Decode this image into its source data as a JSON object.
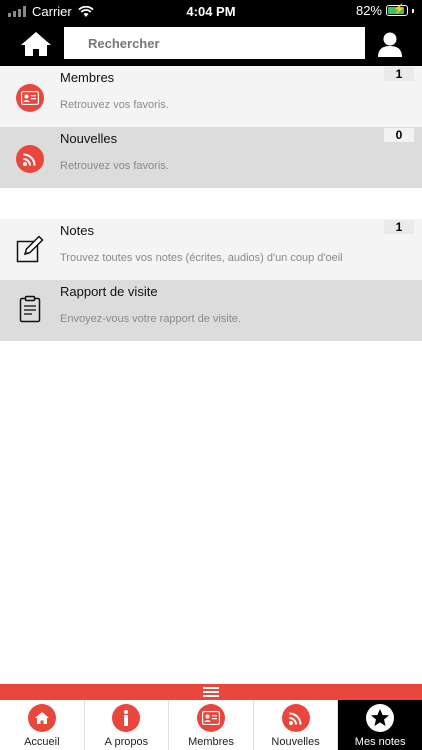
{
  "status": {
    "carrier": "Carrier",
    "time": "4:04 PM",
    "battery": "82%"
  },
  "topbar": {
    "search_placeholder": "Rechercher"
  },
  "list": {
    "items": [
      {
        "title": "Membres",
        "subtitle": "Retrouvez vos favoris.",
        "count": "1",
        "icon": "member-card-icon"
      },
      {
        "title": "Nouvelles",
        "subtitle": "Retrouvez vos favoris.",
        "count": "0",
        "icon": "rss-icon"
      },
      {
        "title": "Notes",
        "subtitle": "Trouvez toutes vos notes (écrites, audios) d'un coup d'oeil",
        "count": "1",
        "icon": "edit-note-icon"
      },
      {
        "title": "Rapport de visite",
        "subtitle": "Envoyez-vous votre rapport de visite.",
        "count": "",
        "icon": "clipboard-icon"
      }
    ]
  },
  "tabs": [
    {
      "label": "Accueil",
      "icon": "home-icon"
    },
    {
      "label": "A propos",
      "icon": "info-icon"
    },
    {
      "label": "Membres",
      "icon": "member-card-icon"
    },
    {
      "label": "Nouvelles",
      "icon": "rss-icon"
    },
    {
      "label": "Mes notes",
      "icon": "star-icon",
      "active": true
    }
  ],
  "colors": {
    "accent": "#e9473e",
    "bar": "#000000",
    "row_light": "#f4f4f4",
    "row_dark": "#dcdcdc"
  }
}
